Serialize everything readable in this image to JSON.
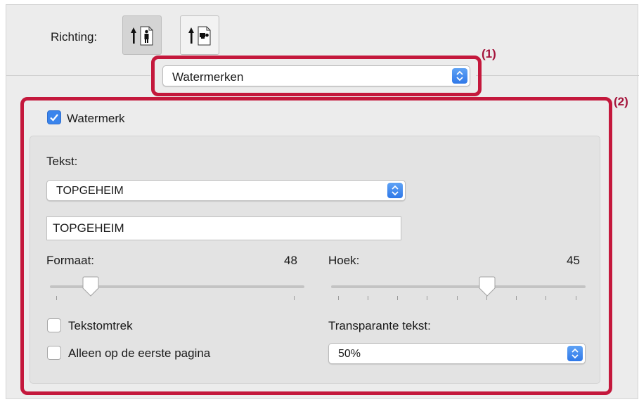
{
  "orientation": {
    "label": "Richting:",
    "options": [
      "portrait-orientation-icon",
      "landscape-orientation-icon"
    ],
    "selected": 0
  },
  "section_popup": {
    "value": "Watermerken"
  },
  "annotations": {
    "one": "(1)",
    "two": "(2)"
  },
  "watermark": {
    "enabled_label": "Watermerk",
    "enabled": true,
    "text_label": "Tekst:",
    "text_select_value": "TOPGEHEIM",
    "text_field_value": "TOPGEHEIM",
    "size_label": "Formaat:",
    "size_value": "48",
    "angle_label": "Hoek:",
    "angle_value": "45",
    "outline_label": "Tekstomtrek",
    "outline_checked": false,
    "first_page_label": "Alleen op de eerste pagina",
    "first_page_checked": false,
    "transparency_label": "Transparante tekst:",
    "transparency_value": "50%"
  },
  "colors": {
    "annotation": "#c4183c",
    "accent": "#3a84ec"
  }
}
